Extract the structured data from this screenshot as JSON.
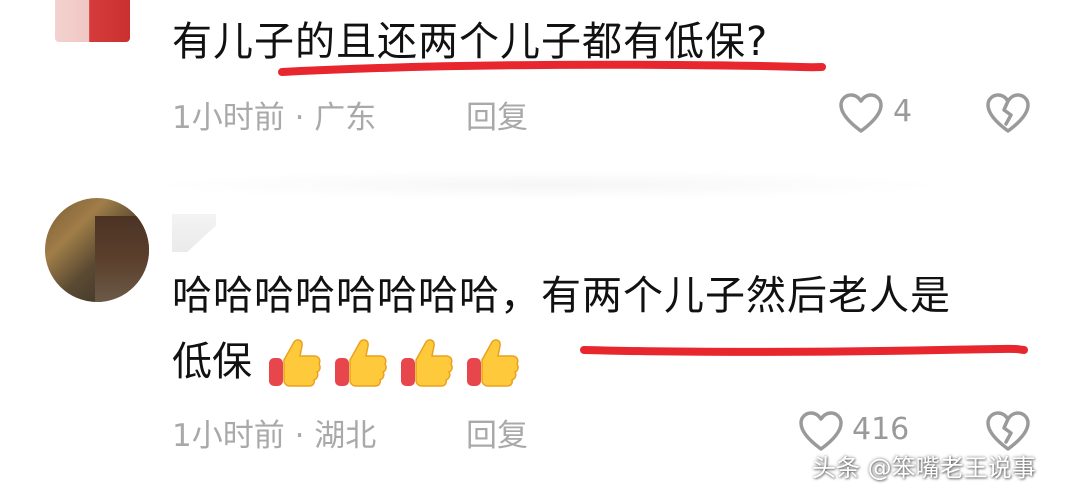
{
  "comment1": {
    "text": "有儿子的且还两个儿子都有低保?",
    "time": "1小时前",
    "location": "广东",
    "reply_label": "回复",
    "like_count": "4"
  },
  "comment2": {
    "line1": "哈哈哈哈哈哈哈哈，有两个儿子然后老人是",
    "line2": "低保",
    "time": "1小时前",
    "location": "湖北",
    "reply_label": "回复",
    "like_count": "416"
  },
  "meta_separator": " · ",
  "watermark": "头条 @笨嘴老王说事",
  "colors": {
    "underline": "#e8262e",
    "meta_text": "#a9a9a9",
    "main_text": "#111111"
  },
  "icons": {
    "like": "heart-outline-icon",
    "dislike": "broken-heart-icon",
    "emoji": "thumbs-up-emoji-icon"
  }
}
